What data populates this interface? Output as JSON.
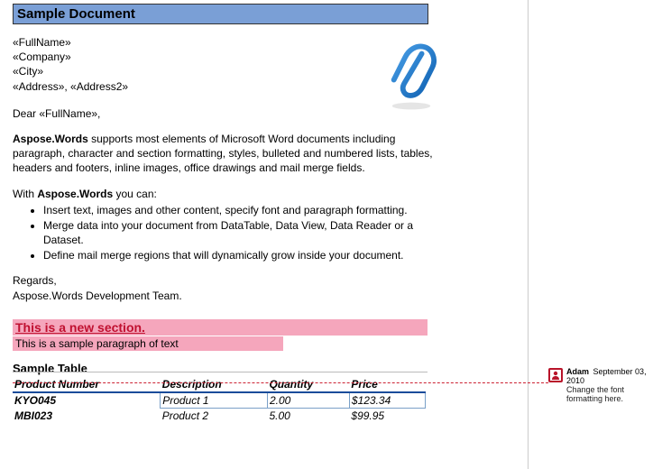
{
  "title": "Sample Document",
  "address": {
    "fullname": "«FullName»",
    "company": "«Company»",
    "city": "«City»",
    "addr": "«Address», «Address2»"
  },
  "greeting_prefix": "Dear ",
  "greeting_field": "«FullName»",
  "greeting_suffix": ",",
  "body_prefix": "Aspose.Words",
  "body_rest": " supports most elements of Microsoft Word documents including paragraph, character and section formatting, styles, bulleted and numbered lists, tables, headers and footers, inline images, office drawings and mail merge fields.",
  "list_intro_prefix": "With ",
  "list_intro_bold": "Aspose.Words",
  "list_intro_suffix": " you can:",
  "bullets": [
    "Insert text, images and other content, specify font and paragraph formatting.",
    "Merge data into your document from DataTable, Data View, Data Reader or a Dataset.",
    "Define mail merge regions that will dynamically grow inside your document."
  ],
  "regards1": "Regards,",
  "regards2": "Aspose.Words Development Team.",
  "section_title": "This is a new section.",
  "section_sub": "This is a sample paragraph of text",
  "table_title": "Sample Table",
  "table": {
    "headers": [
      "Product Number",
      "Description",
      "Quantity",
      "Price"
    ],
    "rows": [
      {
        "pn": "KYO045",
        "desc": "Product 1",
        "qty": "2.00",
        "price": "$123.34"
      },
      {
        "pn": "MBI023",
        "desc": "Product 2",
        "qty": "5.00",
        "price": "$99.95"
      }
    ]
  },
  "comment": {
    "author": "Adam",
    "date": "September 03, 2010",
    "text": "Change the font formatting here."
  }
}
